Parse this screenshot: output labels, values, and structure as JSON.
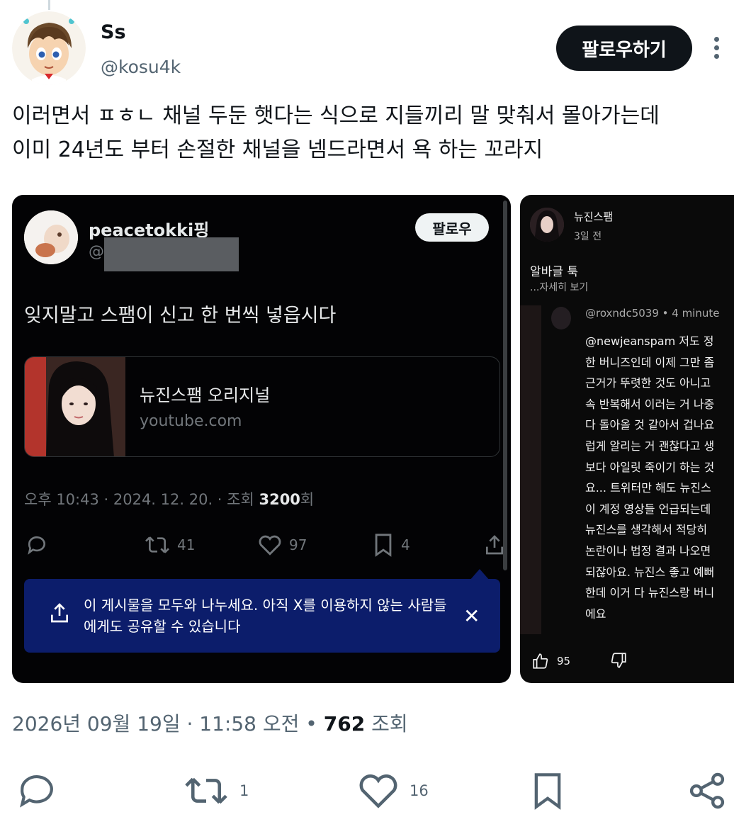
{
  "author": {
    "name": "Ss",
    "handle": "@kosu4k",
    "follow_label": "팔로우하기"
  },
  "tweet": {
    "line1": "이러면서 ㅍㅎㄴ 채널 두둔 햇다는 식으로 지들끼리 말 맞춰서 몰아가는데",
    "line2": "이미 24년도 부터 손절한 채널을 넴드라면서 욕 하는 꼬라지"
  },
  "embedded_post": {
    "name": "peacetokki핑",
    "handle_prefix": "@",
    "follow_label": "팔로우",
    "text": "잊지말고 스팸이 신고 한 번씩 넣읍시다",
    "card_title": "뉴진스팸 오리지널",
    "card_domain": "youtube.com",
    "meta_prefix": "오후 10:43 · 2024. 12. 20. · 조회 ",
    "meta_views": "3200",
    "meta_suffix": "회",
    "reply_icon": "reply-icon",
    "retweets": "41",
    "likes": "97",
    "bookmarks": "4",
    "share_toast": "이 게시물을 모두와 나누세요. 아직 X를 이용하지 않는 사람들에게도 공유할 수 있습니다",
    "toast_close": "✕"
  },
  "youtube_post": {
    "channel": "뉴진스팸",
    "time": "3일 전",
    "title": "알바글 툭",
    "more_label": "...자세히 보기",
    "comment_user": "@roxndc5039 • 4 minute",
    "comment_lines": [
      " @newjeanspam 저도 정",
      "한 버니즈인데 이제 그만 좀",
      "근거가 뚜렷한 것도 아니고",
      "속 반복해서 이러는 거 나중",
      "다 돌아올 것 같아서 겁나요",
      "럽게 알리는 거 괜찮다고 생",
      "보다 아일릿 죽이기 하는 것",
      "요... 트위터만 해도 뉴진스",
      "이 계정 영상들 언급되는데",
      "뉴진스를 생각해서 적당히",
      "논란이나 법정 결과 나오면",
      "되잖아요. 뉴진스 좋고 예뻐",
      "한데 이거 다 뉴진스랑 버니",
      "에요"
    ],
    "likes": "95"
  },
  "footer": {
    "meta_prefix": "2026년 09월 19일 · 11:58 오전 • ",
    "views": "762",
    "views_suffix": " 조회",
    "retweets": "1",
    "likes": "16"
  }
}
